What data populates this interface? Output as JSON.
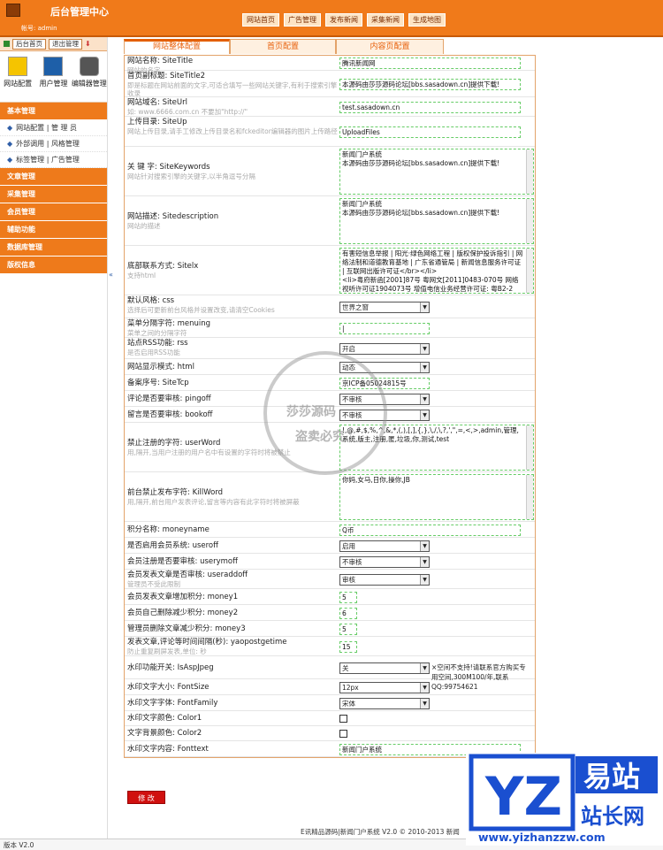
{
  "header": {
    "title": "后台管理中心",
    "user_line": "帐号: admin",
    "nav": [
      "网站首页",
      "广告管理",
      "发布新闻",
      "采集新闻",
      "生成地图"
    ]
  },
  "sidebar": {
    "head_buttons": [
      "后台首页",
      "退出管理"
    ],
    "quick_icons": [
      "网站配置",
      "用户管理",
      "编辑器管理"
    ],
    "sections": [
      {
        "title": "基本管理",
        "items": [
          [
            "网站配置",
            "管 理 员"
          ],
          [
            "外部调用",
            "风格管理"
          ],
          [
            "标签管理",
            "广告管理"
          ]
        ]
      },
      {
        "title": "文章管理"
      },
      {
        "title": "采集管理"
      },
      {
        "title": "会员管理"
      },
      {
        "title": "辅助功能"
      },
      {
        "title": "数据库管理"
      },
      {
        "title": "版权信息"
      }
    ]
  },
  "collapse_glyph": "«",
  "tabs": [
    "网站整体配置",
    "首页配置",
    "内容页配置"
  ],
  "form": [
    {
      "label": "网站名称: SiteTitle",
      "hint": "网站的名字",
      "type": "input",
      "value": "腾讯新闻网",
      "w": 205,
      "h": 17
    },
    {
      "label": "首页副标题: SiteTitle2",
      "hint": "即是标题在网站前面的文字,可适合填写一些网站关键字,有利于搜索引擎收录",
      "type": "input",
      "value": "本源码由莎莎源码论坛[bbs.sasadown.cn]提供下载!",
      "w": 205,
      "h": 30
    },
    {
      "label": "网站域名: SiteUrl",
      "hint": "如: www.6666.com.cn 不要加\"http://\"",
      "type": "input",
      "value": "test.sasadown.cn",
      "w": 205,
      "h": 22
    },
    {
      "label": "上传目录: SiteUp",
      "hint": "网站上传目录,请手工修改上传目录名和fckeditor编辑器的图片上传路径",
      "type": "input",
      "value": "UploadFiles",
      "w": 205,
      "h": 34
    },
    {
      "label": "关 键 字: SiteKeywords",
      "hint": "网站针对搜索引擎的关键字,以半角逗号分隔",
      "type": "textarea",
      "value": "新闻门户系统\n本源码由莎莎源码论坛[bbs.sasadown.cn]提供下载!",
      "w": 220,
      "h": 56
    },
    {
      "label": "网站描述: Sitedescription",
      "hint": "网站的描述",
      "type": "textarea",
      "value": "新闻门户系统\n本源码由莎莎源码论坛[bbs.sasadown.cn]提供下载!",
      "w": 220,
      "h": 56
    },
    {
      "label": "底部联系方式: Sitelx",
      "hint": "支持html",
      "type": "textarea",
      "value": "有害短信息举报 | 阳光·绿色网络工程 | 版权保护投诉指引 | 网络法制和道德教育基地 | 广东省通管局 | 新闻信息服务许可证 | 互联网出版许可证</br></li>\n<li>粤府新函[2001]87号 粤网文[2011]0483-070号 网络视听许可证1904073号 增值电信业务经营许可证: 粤B2-2",
      "w": 220,
      "h": 56
    },
    {
      "label": "默认风格: css",
      "hint": "选择后可更新前台风格并设置改变,请清空Cookies",
      "type": "select",
      "value": "世界之窗",
      "h": 26
    },
    {
      "label": "菜单分隔字符: menuing",
      "hint": "菜单之间的分隔字符",
      "type": "input",
      "value": "|",
      "w": 102,
      "h": 22
    },
    {
      "label": "站点RSS功能: rss",
      "hint": "是否启用RSS功能",
      "type": "select",
      "value": "开启",
      "h": 24
    },
    {
      "label": "网站显示模式: html",
      "hint": "",
      "type": "select",
      "value": "动态",
      "h": 18
    },
    {
      "label": "备案序号: SiteTcp",
      "hint": "",
      "type": "input",
      "value": "京ICP备05024815号",
      "w": 102,
      "h": 18
    },
    {
      "label": "评论是否要审核: pingoff",
      "hint": "",
      "type": "select",
      "value": "不审核",
      "h": 18
    },
    {
      "label": "留言是否要审核: bookoff",
      "hint": "",
      "type": "select",
      "value": "不审核",
      "h": 18
    },
    {
      "label": "禁止注册的字符: userWord",
      "hint": "用,隔开,当用户注册的用户名中有设置的字符时将被禁止",
      "type": "textarea",
      "value": "!,@,#,$,%,^,&,*,(,),[,],{,},\\,/,\\,?,',\",=,<,>,admin,管理,系统,版主,注册,匿,垃圾,你,测试,test",
      "w": 220,
      "h": 56
    },
    {
      "label": "前台禁止发布字符: KillWord",
      "hint": "用,隔开,前台用户发表评论,留言等内容有此字符时将被屏蔽",
      "type": "textarea",
      "value": "你妈,女马,日你,操你,JB",
      "w": 220,
      "h": 56
    },
    {
      "label": "积分名称: moneyname",
      "hint": "",
      "type": "input",
      "value": "Q币",
      "w": 205,
      "h": 18
    },
    {
      "label": "是否启用会员系统: useroff",
      "hint": "",
      "type": "select",
      "value": "启用",
      "h": 18
    },
    {
      "label": "会员注册是否要审核: userymoff",
      "hint": "",
      "type": "select",
      "value": "不审核",
      "h": 18
    },
    {
      "label": "会员发表文章是否审核: useraddoff",
      "hint": "管理员不受此限制",
      "type": "select",
      "value": "审核",
      "h": 22
    },
    {
      "label": "会员发表文章增加积分: money1",
      "hint": "",
      "type": "input",
      "value": "5",
      "w": 20,
      "h": 18
    },
    {
      "label": "会员自己删除减少积分: money2",
      "hint": "",
      "type": "input",
      "value": "6",
      "w": 20,
      "h": 18
    },
    {
      "label": "管理员删除文章减少积分: money3",
      "hint": "",
      "type": "input",
      "value": "5",
      "w": 20,
      "h": 18
    },
    {
      "label": "发表文章,评论等时间间隔(秒): yaopostgetime",
      "hint": "防止重复刷屏发表,单位: 秒",
      "type": "input",
      "value": "15",
      "w": 20,
      "h": 22
    },
    {
      "label": "水印功能开关: IsAspJpeg",
      "hint": "",
      "type": "select",
      "value": "关",
      "note": "×空间不支持!请联系官方购买专用空间,300M100/年,联系QQ:99754621",
      "h": 26
    },
    {
      "label": "水印文字大小: FontSize",
      "hint": "",
      "type": "select",
      "value": "12px",
      "h": 18
    },
    {
      "label": "水印文字字体: FontFamily",
      "hint": "",
      "type": "select",
      "value": "宋体",
      "h": 18
    },
    {
      "label": "水印文字颜色: Color1",
      "hint": "",
      "type": "checkbox",
      "h": 17
    },
    {
      "label": "文字背景颜色: Color2",
      "hint": "",
      "type": "checkbox",
      "h": 17
    },
    {
      "label": "水印文字内容: Fonttext",
      "hint": "",
      "type": "input",
      "value": "新闻门户系统",
      "w": 205,
      "h": 18
    }
  ],
  "submit_label": "修 改",
  "stamp": {
    "line1": "莎莎源码",
    "line2": "盗卖必究"
  },
  "footer": "E讯精品源码|新闻门户系统 V2.0 © 2010-2013 新闻",
  "bottom_version": "版本 V2.0",
  "watermark": {
    "brand_latin": "YZ",
    "brand_cn": "易站",
    "sub_cn": "站长网",
    "url": "www.yizhanzzw.com"
  },
  "colors": {
    "orange": "#f07a1a",
    "dark_orange": "#c85a08",
    "submit": "#d0100f",
    "blue": "#1a4fd0"
  }
}
